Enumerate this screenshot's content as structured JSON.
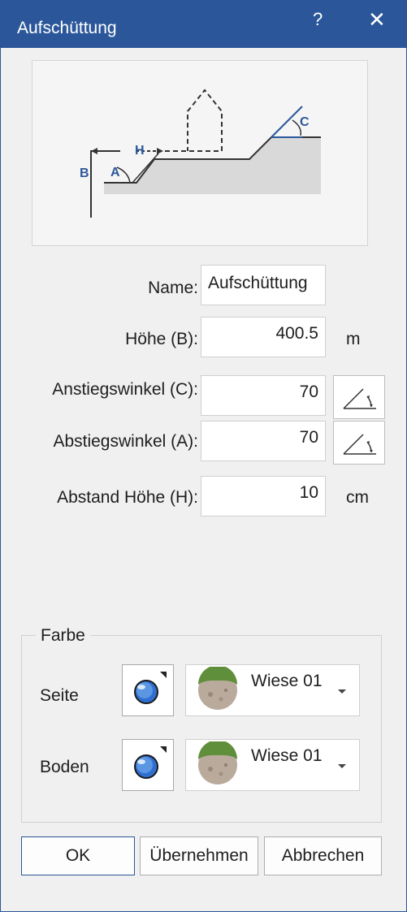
{
  "dialog": {
    "title": "Aufschüttung",
    "help_glyph": "?",
    "close_glyph": "✕"
  },
  "diagram": {
    "label_b": "B",
    "label_h": "H",
    "label_a": "A",
    "label_c": "C"
  },
  "form": {
    "name_label": "Name:",
    "name_value": "Aufschüttung",
    "height_label": "Höhe (B):",
    "height_value": "400.5",
    "height_unit": "m",
    "rise_label": "Anstiegswinkel (C):",
    "rise_value": "70",
    "fall_label": "Abstiegswinkel (A):",
    "fall_value": "70",
    "dist_label": "Abstand Höhe (H):",
    "dist_value": "10",
    "dist_unit": "cm"
  },
  "color_group": {
    "legend": "Farbe",
    "side_label": "Seite",
    "side_texture": "Wiese 01",
    "floor_label": "Boden",
    "floor_texture": "Wiese 01"
  },
  "buttons": {
    "ok": "OK",
    "apply": "Übernehmen",
    "cancel": "Abbrechen"
  },
  "icons": [
    "help-icon",
    "close-icon",
    "angle-icon",
    "sphere-icon",
    "texture-icon",
    "dropdown-arrow-icon"
  ],
  "colors": {
    "titlebar": "#2b579a",
    "accent": "#2b579a",
    "dialog_bg": "#f0f0f0"
  }
}
